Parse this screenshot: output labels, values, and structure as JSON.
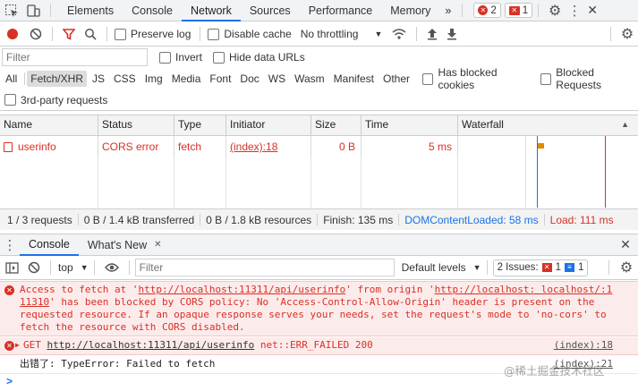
{
  "tabs": [
    "Elements",
    "Console",
    "Network",
    "Sources",
    "Performance",
    "Memory"
  ],
  "tabs_more": "»",
  "badges": {
    "errors": "2",
    "issues": "1"
  },
  "toolbar": {
    "preserve_log": "Preserve log",
    "disable_cache": "Disable cache",
    "throttling": "No throttling"
  },
  "filter": {
    "placeholder": "Filter",
    "invert": "Invert",
    "hide_data_urls": "Hide data URLs"
  },
  "types": [
    "All",
    "Fetch/XHR",
    "JS",
    "CSS",
    "Img",
    "Media",
    "Font",
    "Doc",
    "WS",
    "Wasm",
    "Manifest",
    "Other"
  ],
  "blocked_cookies": "Has blocked cookies",
  "blocked_requests": "Blocked Requests",
  "third_party": "3rd-party requests",
  "columns": [
    "Name",
    "Status",
    "Type",
    "Initiator",
    "Size",
    "Time",
    "Waterfall"
  ],
  "request": {
    "name": "userinfo",
    "status": "CORS error",
    "type": "fetch",
    "initiator": "(index):18",
    "size": "0 B",
    "time": "5 ms"
  },
  "status": {
    "requests": "1 / 3 requests",
    "transferred": "0 B / 1.4 kB transferred",
    "resources": "0 B / 1.8 kB resources",
    "finish": "Finish: 135 ms",
    "dcl": "DOMContentLoaded: 58 ms",
    "load": "Load: 111 ms"
  },
  "drawer_tabs": [
    "Console",
    "What's New"
  ],
  "console_toolbar": {
    "context": "top",
    "filter_placeholder": "Filter",
    "levels": "Default levels",
    "issues_label": "2 Issues:",
    "issues_err": "1",
    "issues_info": "1"
  },
  "messages": {
    "err1_a": "Access to fetch at '",
    "err1_url1": "http://localhost:11311/api/userinfo",
    "err1_b": "' from origin '",
    "err1_url2": "http://localhost: localhost/:1",
    "err1_c": "11310",
    "err1_d": "' has been blocked by CORS policy: No 'Access-Control-Allow-Origin' header is present on the requested resource. If an opaque response serves your needs, set the request's mode to 'no-cors' to fetch the resource with CORS disabled.",
    "err2_method": "GET",
    "err2_url": "http://localhost:11311/api/userinfo",
    "err2_rest": "net::ERR_FAILED 200",
    "err2_src": "(index):18",
    "log_text": "出错了: TypeError: Failed to fetch",
    "log_src": "(index):21"
  },
  "prompt": ">",
  "watermark": "@稀土掘金技术社区",
  "colors": {
    "accent": "#1a73e8",
    "error": "#d93025",
    "error_bg": "#fcebeb"
  }
}
